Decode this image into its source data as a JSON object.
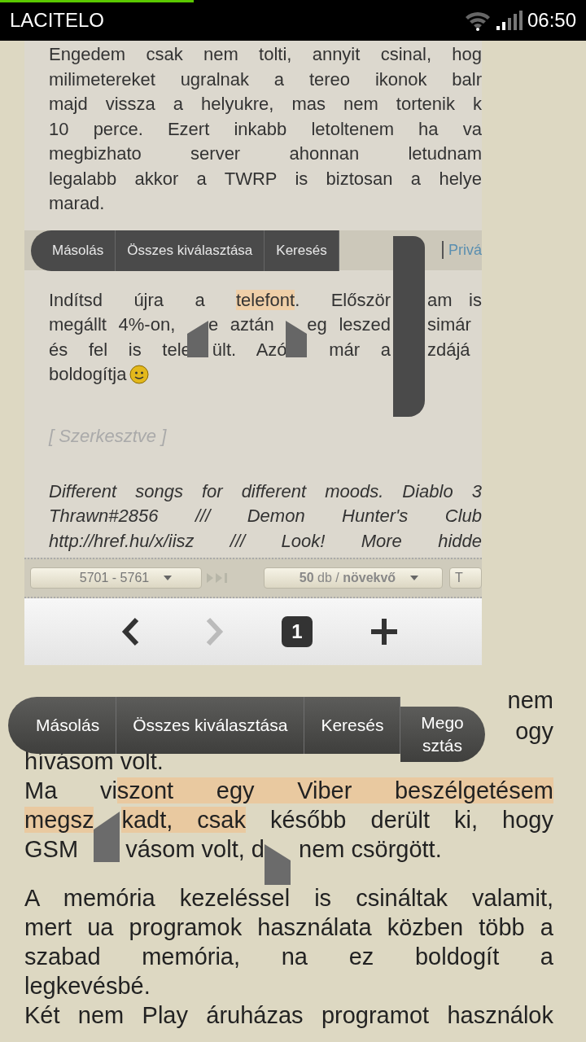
{
  "status_bar": {
    "carrier": "LACITELO",
    "time": "06:50",
    "load_progress": {
      "level": 0.33
    }
  },
  "embedded_screenshot": {
    "intro_lines": [
      "Engedem csak nem tolti, annyit csinal, hog",
      "milimetereket ugralnak a tereo ikonok balr",
      "majd vissza a helyukre, mas nem tortenik k",
      "10 perce. Ezert inkabb letoltenem ha va",
      "megbizhato server ahonnan letudnam",
      "legalabb akkor a TWRP is biztosan a helye",
      "marad."
    ],
    "header_link": "Privá",
    "selection_toolbar": {
      "items": [
        "Másolás",
        "Összes kiválasztása",
        "Keresés"
      ]
    },
    "post_lines": [
      {
        "segments": [
          {
            "kind": "text",
            "text": "Indítsd újra a ",
            "selected": false
          },
          {
            "kind": "text",
            "text": "telefont",
            "selected": true
          },
          {
            "kind": "text",
            "text": ". Először",
            "selected": false
          }
        ],
        "after_gap": "am is"
      },
      {
        "segments": [
          {
            "kind": "text",
            "text": "megállt 4%-on, ",
            "selected": false
          },
          {
            "kind": "start_handle"
          },
          {
            "kind": "text",
            "text": "e aztán ",
            "selected": false
          },
          {
            "kind": "end_handle"
          },
          {
            "kind": "text",
            "text": "eg leszed",
            "selected": false
          }
        ],
        "after_gap": "simár"
      },
      {
        "segments": [
          {
            "kind": "text",
            "text": "és fel is tele",
            "selected": false
          },
          {
            "kind": "covered"
          },
          {
            "kind": "text",
            "text": "ült. Azó",
            "selected": false
          },
          {
            "kind": "covered"
          },
          {
            "kind": "text",
            "text": " már a",
            "selected": false
          }
        ],
        "after_gap": "zdájá"
      },
      {
        "segments": [
          {
            "kind": "text",
            "text": "boldogítja",
            "selected": false
          }
        ],
        "emoji": true
      }
    ],
    "edited_note": "[ Szerkesztve ]",
    "signature_lines": [
      "Different songs for different moods. Diablo 3",
      "Thrawn#2856 /// Demon Hunter's Club",
      "http://href.hu/x/iisz /// Look! More hidde"
    ],
    "pager": {
      "range": "5701 - 5761",
      "order": "**50** db / **növekvő**",
      "cut_dropdown": "T"
    },
    "browser_bar": {
      "back_disabled": false,
      "forward_disabled": true,
      "tab_count": "1"
    }
  },
  "hidden_fragments": [
    "nem",
    "ogy"
  ],
  "selection_toolbar": {
    "items": [
      "Másolás",
      "Összes kiválasztása",
      "Keresés",
      "Megosztás"
    ]
  },
  "paragraphs": [
    {
      "lines": [
        {
          "justified": false,
          "segments": [
            {
              "kind": "text",
              "text": "hívásom volt.",
              "selected": false
            }
          ]
        },
        {
          "justified": true,
          "segments": [
            {
              "kind": "text",
              "text": "Ma vi",
              "selected": false
            },
            {
              "kind": "text",
              "text": "szont egy Viber beszélgetésem",
              "selected": true
            }
          ]
        },
        {
          "justified": true,
          "segments": [
            {
              "kind": "text",
              "text": "megsz",
              "selected": true
            },
            {
              "kind": "start_handle"
            },
            {
              "kind": "text",
              "text": "kadt, csak",
              "selected": true
            },
            {
              "kind": "text",
              "text": " később derült ki, hogy",
              "selected": false
            }
          ]
        },
        {
          "justified": false,
          "segments": [
            {
              "kind": "text",
              "text": "GSM ",
              "selected": false
            },
            {
              "kind": "covered"
            },
            {
              "kind": "text",
              "text": "vásom volt, d",
              "selected": false
            },
            {
              "kind": "end_handle"
            },
            {
              "kind": "text",
              "text": " nem csörgött.",
              "selected": false
            }
          ]
        }
      ]
    },
    {
      "lines": [
        {
          "justified": true,
          "segments": [
            {
              "kind": "text",
              "text": "A memória kezeléssel is csináltak valamit,",
              "selected": false
            }
          ]
        },
        {
          "justified": true,
          "segments": [
            {
              "kind": "text",
              "text": "mert ua programok használata közben több a",
              "selected": false
            }
          ]
        },
        {
          "justified": true,
          "segments": [
            {
              "kind": "text",
              "text": "szabad memória, na ez boldogít a",
              "selected": false
            }
          ]
        },
        {
          "segments": [
            {
              "kind": "text",
              "text": "legkevésbé.",
              "selected": false
            }
          ]
        },
        {
          "justified": true,
          "segments": [
            {
              "kind": "text",
              "text": "Két nem Play áruházas programot használok",
              "selected": false
            }
          ]
        }
      ]
    }
  ]
}
